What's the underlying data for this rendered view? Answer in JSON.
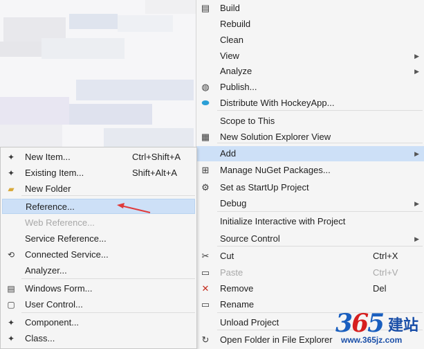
{
  "main_menu": {
    "items": [
      {
        "label": "Build",
        "icon": "build-icon",
        "glyph": "▤"
      },
      {
        "label": "Rebuild"
      },
      {
        "label": "Clean"
      },
      {
        "label": "View",
        "submenu": true
      },
      {
        "label": "Analyze",
        "submenu": true
      },
      {
        "label": "Publish...",
        "icon": "globe-icon",
        "glyph": "◍"
      },
      {
        "label": "Distribute With HockeyApp...",
        "icon": "hockeyapp-icon",
        "glyph": "⬬"
      },
      {
        "label": "Scope to This"
      },
      {
        "label": "New Solution Explorer View",
        "icon": "solution-explorer-icon",
        "glyph": "▦"
      },
      {
        "label": "Add",
        "submenu": true,
        "highlighted": true
      },
      {
        "label": "Manage NuGet Packages...",
        "icon": "nuget-icon",
        "glyph": "⊞"
      },
      {
        "label": "Set as StartUp Project",
        "icon": "gear-icon",
        "glyph": "⚙"
      },
      {
        "label": "Debug",
        "submenu": true
      },
      {
        "label": "Initialize Interactive with Project"
      },
      {
        "label": "Source Control",
        "submenu": true
      },
      {
        "label": "Cut",
        "shortcut": "Ctrl+X",
        "icon": "scissors-icon",
        "glyph": "✂"
      },
      {
        "label": "Paste",
        "shortcut": "Ctrl+V",
        "icon": "paste-icon",
        "glyph": "▭",
        "disabled": true
      },
      {
        "label": "Remove",
        "shortcut": "Del",
        "icon": "remove-icon",
        "glyph": "✕",
        "color": "#c42b1c"
      },
      {
        "label": "Rename",
        "icon": "rename-icon",
        "glyph": "▭"
      },
      {
        "label": "Unload Project"
      },
      {
        "label": "Open Folder in File Explorer",
        "icon": "refresh-icon",
        "glyph": "↻"
      }
    ]
  },
  "add_submenu": {
    "items": [
      {
        "label": "New Item...",
        "shortcut": "Ctrl+Shift+A",
        "icon": "new-item-icon",
        "glyph": "✦"
      },
      {
        "label": "Existing Item...",
        "shortcut": "Shift+Alt+A",
        "icon": "existing-item-icon",
        "glyph": "✦"
      },
      {
        "label": "New Folder",
        "icon": "folder-icon",
        "glyph": "▰",
        "color": "#d8a93a"
      },
      {
        "label": "Reference...",
        "highlighted": true
      },
      {
        "label": "Web Reference...",
        "disabled": true
      },
      {
        "label": "Service Reference..."
      },
      {
        "label": "Connected Service...",
        "icon": "connected-service-icon",
        "glyph": "⟲"
      },
      {
        "label": "Analyzer..."
      },
      {
        "label": "Windows Form...",
        "icon": "windows-form-icon",
        "glyph": "▤"
      },
      {
        "label": "User Control...",
        "icon": "user-control-icon",
        "glyph": "▢"
      },
      {
        "label": "Component...",
        "icon": "component-icon",
        "glyph": "✦"
      },
      {
        "label": "Class...",
        "icon": "class-icon",
        "glyph": "✦"
      }
    ]
  },
  "watermark": {
    "logo_3": "3",
    "logo_6": "6",
    "logo_5": "5",
    "text_cn": "建站",
    "url": "www.365jz.com"
  },
  "colors": {
    "highlight": "#cde0f7",
    "menu_bg": "#f5f5f5",
    "annotation": "#e03a3a",
    "watermark_blue": "#1a4fa8",
    "watermark_red": "#d61f1f"
  }
}
